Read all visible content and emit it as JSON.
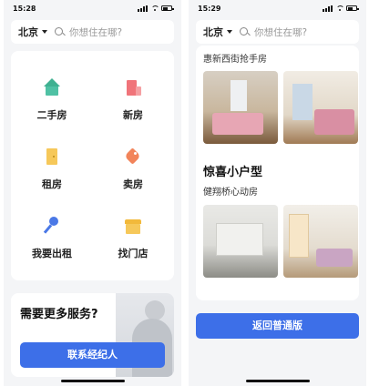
{
  "left": {
    "status": {
      "time": "15:28"
    },
    "search": {
      "city": "北京",
      "placeholder": "你想住在哪?"
    },
    "services": [
      {
        "label": "二手房",
        "icon": "house-icon"
      },
      {
        "label": "新房",
        "icon": "new-house-icon"
      },
      {
        "label": "租房",
        "icon": "rent-door-icon"
      },
      {
        "label": "卖房",
        "icon": "price-tag-icon"
      },
      {
        "label": "我要出租",
        "icon": "key-icon"
      },
      {
        "label": "找门店",
        "icon": "store-icon"
      }
    ],
    "promo": {
      "title": "需要更多服务?",
      "button": "联系经纪人"
    }
  },
  "right": {
    "status": {
      "time": "15:29"
    },
    "search": {
      "city": "北京",
      "placeholder": "你想住在哪?"
    },
    "feed": {
      "section1_subtitle": "惠新西街抢手房",
      "section2_title": "惊喜小户型",
      "section2_subtitle": "健翔桥心动房"
    },
    "return_button": "返回普通版"
  },
  "colors": {
    "accent": "#3d6fe8",
    "page_bg": "#f4f5f7"
  }
}
